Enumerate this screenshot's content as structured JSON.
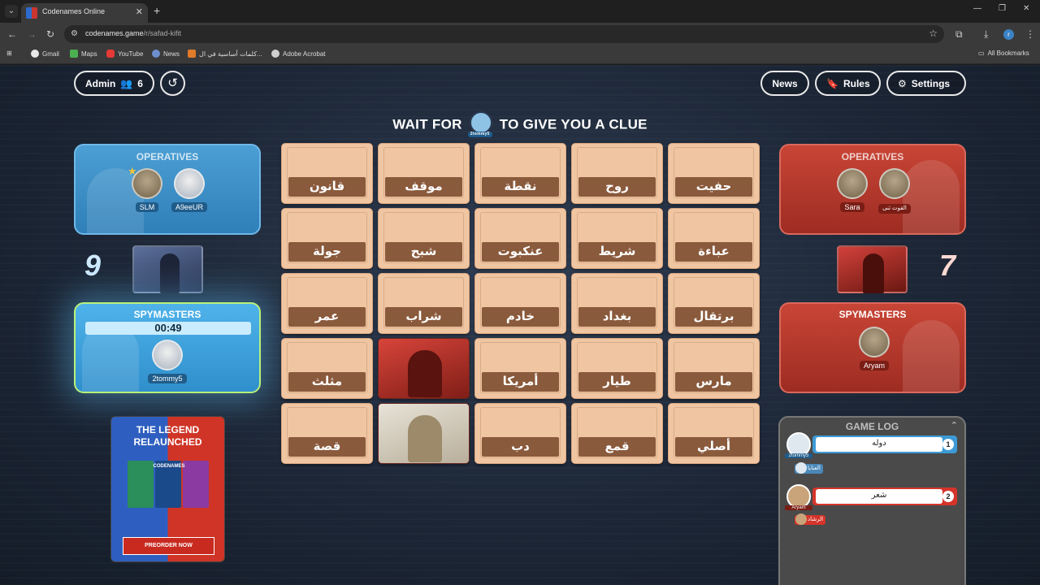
{
  "browser": {
    "tab_title": "Codenames Online",
    "url_host": "codenames.game",
    "url_path": "/r/safad-kifit",
    "profile_initial": "r",
    "bookmarks": [
      "Gmail",
      "Maps",
      "YouTube",
      "News",
      "كلمات أساسية في ال...",
      "Adobe Acrobat"
    ],
    "all_bookmarks": "All Bookmarks"
  },
  "header": {
    "admin_label": "Admin",
    "player_count": "6",
    "news_label": "News",
    "rules_label": "Rules",
    "settings_label": "Settings"
  },
  "banner": {
    "before": "WAIT FOR",
    "after": "TO GIVE YOU A CLUE",
    "avatar_name": "2tommy5"
  },
  "blue_team": {
    "operatives_title": "OPERATIVES",
    "operatives": [
      "SLM",
      "A9eeUR"
    ],
    "score": "9",
    "spymasters_title": "SPYMASTERS",
    "timer": "00:49",
    "spymaster": "2tommy5",
    "color": "#3b8fcb"
  },
  "red_team": {
    "operatives_title": "OPERATIVES",
    "operatives": [
      "Sara",
      "القوت ثنى"
    ],
    "score": "7",
    "spymasters_title": "SPYMASTERS",
    "spymaster": "Aryam",
    "color": "#c0392b"
  },
  "board": {
    "cards": [
      "قانون",
      "موقف",
      "نقطة",
      "روح",
      "حفيت",
      "جولة",
      "شبح",
      "عنكبوت",
      "شريط",
      "عباءة",
      "عمر",
      "شراب",
      "خادم",
      "بغداد",
      "برتقال",
      "مثلث",
      "",
      "أمريكا",
      "طيار",
      "مارس",
      "قصة",
      "",
      "دب",
      "قمع",
      "أصلي"
    ],
    "revealed": {
      "16": "red",
      "21": "neutral"
    }
  },
  "ad": {
    "title_line1": "THE LEGEND",
    "title_line2": "RELAUNCHED",
    "box_label": "CODENAMES",
    "cta": "PREORDER NOW"
  },
  "game_log": {
    "title": "GAME LOG",
    "entries": [
      {
        "player": "2tommy5",
        "word": "دوله",
        "number": "1",
        "guess": "العنايا"
      },
      {
        "player": "Aryam",
        "word": "شعر",
        "number": "2",
        "guess": "الرشاد"
      }
    ]
  }
}
